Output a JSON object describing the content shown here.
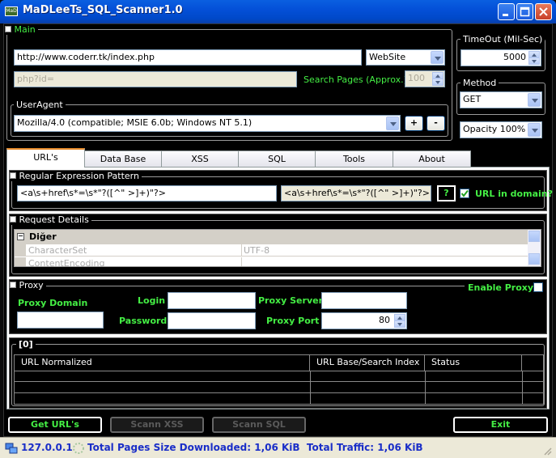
{
  "window": {
    "title": "MaDLeeTs_SQL_Scanner1.0"
  },
  "main": {
    "group_label": "Main",
    "url_value": "http://www.coderr.tk/index.php",
    "source_value": "WebSite",
    "param_placeholder": "php?id=",
    "search_pages_label": "Search Pages (Approx.)",
    "search_pages_value": "100",
    "useragent_label": "UserAgent",
    "useragent_value": "Mozilla/4.0 (compatible; MSIE 6.0b; Windows NT 5.1)",
    "add_label": "+",
    "remove_label": "-"
  },
  "timeout": {
    "label": "TimeOut (Mil-Sec)",
    "value": "5000"
  },
  "method": {
    "label": "Method",
    "value": "GET"
  },
  "opacity": {
    "value": "Opacity 100%"
  },
  "tabs": [
    "URL's",
    "Data Base",
    "XSS",
    "SQL",
    "Tools",
    "About"
  ],
  "regex": {
    "label": "Regular Expression Pattern",
    "pattern_value": "<a\\s+href\\s*=\\s*\"?([^\" >]+)\"?>",
    "pattern_display": "<a\\s+href\\s*=\\s*\"?([^\" >]+)\"?>",
    "help_label": "?",
    "url_in_domain_label": "URL in domain?"
  },
  "request": {
    "label": "Request Details",
    "category": "Diğer",
    "rows": [
      {
        "name": "CharacterSet",
        "value": "UTF-8"
      },
      {
        "name": "ContentEncoding",
        "value": ""
      }
    ]
  },
  "proxy": {
    "label": "Proxy",
    "enable_label": "Enable Proxy",
    "domain_label": "Proxy Domain",
    "login_label": "Login",
    "password_label": "Password",
    "server_label": "Proxy Server",
    "port_label": "Proxy Port",
    "port_value": "80"
  },
  "results": {
    "label": "[0]",
    "columns": [
      "URL Normalized",
      "URL Base/Search Index",
      "Status"
    ]
  },
  "actions": {
    "get_urls": "Get URL's",
    "scan_xss": "Scann XSS",
    "scan_sql": "Scann SQL",
    "exit": "Exit"
  },
  "status": {
    "ip": "127.0.0.1",
    "summary": "Total Pages Size Downloaded: 1,06 KiB  Total Traffic: 1,06 KiB"
  },
  "colors": {
    "accent_green": "#44ee44",
    "title_blue": "#0450d8",
    "status_blue": "#1a2ec8"
  }
}
